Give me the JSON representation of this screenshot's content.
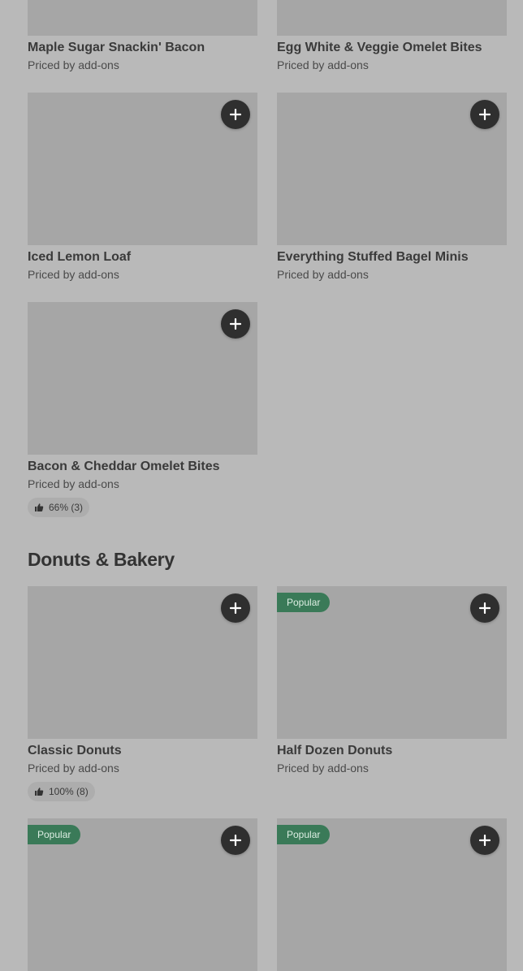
{
  "items": [
    {
      "name": "Maple Sugar Snackin' Bacon",
      "price": "Priced by add-ons"
    },
    {
      "name": "Egg White & Veggie Omelet Bites",
      "price": "Priced by add-ons"
    },
    {
      "name": "Iced Lemon Loaf",
      "price": "Priced by add-ons"
    },
    {
      "name": "Everything Stuffed Bagel Minis",
      "price": "Priced by add-ons"
    },
    {
      "name": "Bacon & Cheddar Omelet Bites",
      "price": "Priced by add-ons",
      "rating": "66% (3)"
    }
  ],
  "section": {
    "title": "Donuts & Bakery",
    "items": [
      {
        "name": "Classic Donuts",
        "price": "Priced by add-ons",
        "rating": "100% (8)"
      },
      {
        "name": "Half Dozen Donuts",
        "price": "Priced by add-ons",
        "badge": "Popular"
      },
      {
        "badge": "Popular"
      },
      {
        "badge": "Popular"
      }
    ]
  },
  "icons": {
    "add": "plus-icon",
    "rating": "thumbs-up-icon"
  },
  "colors": {
    "add_button": "#2f2f2f",
    "badge": "#3a7a58",
    "background": "#b9b9b9",
    "image_placeholder": "#a6a6a6"
  }
}
